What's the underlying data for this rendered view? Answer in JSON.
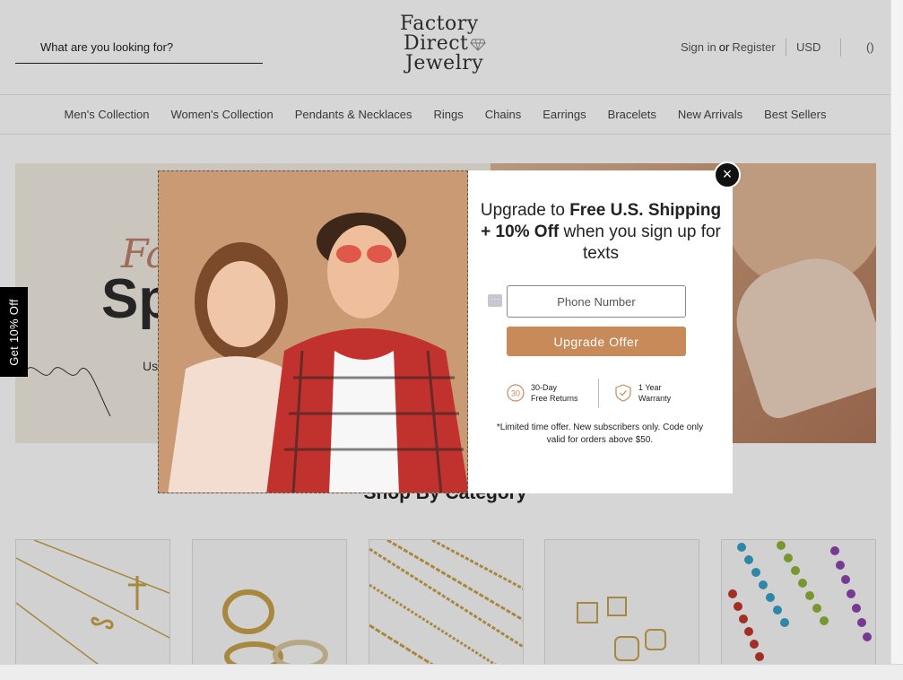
{
  "search": {
    "placeholder": "What are you looking for?"
  },
  "logo": {
    "line1": "Factory",
    "line2": "Direct",
    "line3": "Jewelry"
  },
  "account": {
    "sign_in": "Sign in",
    "or": "or",
    "register": "Register"
  },
  "currency": "USD",
  "cart": {
    "count_label": "()"
  },
  "nav": {
    "items": [
      {
        "label": "Men's Collection"
      },
      {
        "label": "Women's Collection"
      },
      {
        "label": "Pendants & Necklaces"
      },
      {
        "label": "Rings"
      },
      {
        "label": "Chains"
      },
      {
        "label": "Earrings"
      },
      {
        "label": "Bracelets"
      },
      {
        "label": "New Arrivals"
      },
      {
        "label": "Best Sellers"
      }
    ]
  },
  "hero": {
    "script_text": "Fa",
    "big_text": "Sp",
    "sub_text": "Us"
  },
  "side_tab": {
    "label": "Get 10% Off"
  },
  "category_section": {
    "title": "Shop By Category"
  },
  "modal": {
    "headline_part1": "Upgrade to ",
    "headline_bold": "Free U.S. Shipping + 10% Off",
    "headline_part2": " when you sign up for texts",
    "phone_placeholder": "Phone Number",
    "button_label": "Upgrade Offer",
    "badge1": {
      "icon_text": "30",
      "line1": "30-Day",
      "line2": "Free Returns"
    },
    "badge2": {
      "line1": "1 Year",
      "line2": "Warranty"
    },
    "disclaimer": "*Limited time offer. New subscribers only. Code only valid for orders above $50.",
    "close_symbol": "×"
  },
  "colors": {
    "accent": "#c98a5a",
    "side_tab_bg": "#000000",
    "close_bg": "#111111"
  }
}
